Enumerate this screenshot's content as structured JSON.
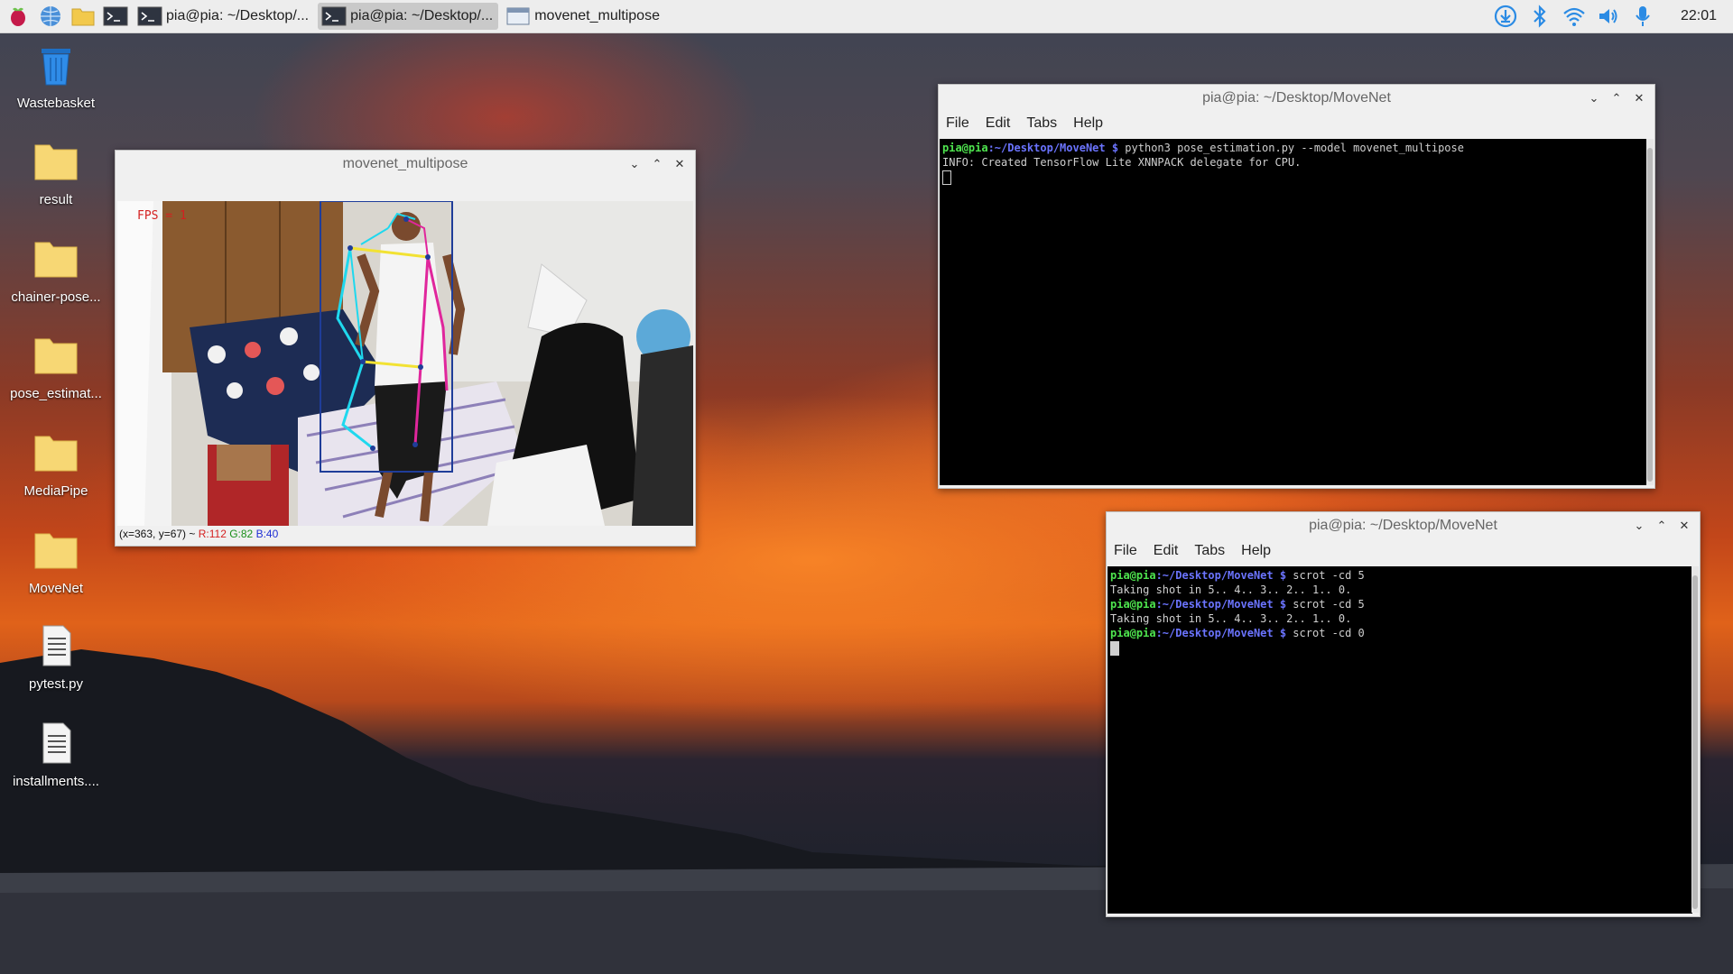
{
  "taskbar": {
    "launchers": [
      {
        "name": "raspberry-menu-icon"
      },
      {
        "name": "browser-icon"
      },
      {
        "name": "file-manager-icon"
      },
      {
        "name": "terminal-icon"
      }
    ],
    "tasks": [
      {
        "label": "pia@pia: ~/Desktop/...",
        "icon": "terminal",
        "active": false
      },
      {
        "label": "pia@pia: ~/Desktop/...",
        "icon": "terminal",
        "active": true
      },
      {
        "label": "movenet_multipose",
        "icon": "window",
        "active": false
      }
    ],
    "tray_icons": [
      "download-icon",
      "bluetooth-icon",
      "wifi-icon",
      "volume-icon",
      "microphone-icon"
    ],
    "clock": "22:01",
    "accent": "#2b8be4"
  },
  "desktop": {
    "icons": [
      {
        "label": "Wastebasket",
        "type": "trash"
      },
      {
        "label": "result",
        "type": "folder"
      },
      {
        "label": "chainer-pose...",
        "type": "folder"
      },
      {
        "label": "pose_estimat...",
        "type": "folder"
      },
      {
        "label": "MediaPipe",
        "type": "folder"
      },
      {
        "label": "MoveNet",
        "type": "folder"
      },
      {
        "label": "pytest.py",
        "type": "file"
      },
      {
        "label": "installments....",
        "type": "file"
      }
    ]
  },
  "camera_window": {
    "title": "movenet_multipose",
    "fps_text": "FPS = 1",
    "status": {
      "coords": "(x=363, y=67) ~",
      "r": "R:112",
      "g": "G:82",
      "b": "B:40"
    }
  },
  "terminal1": {
    "title": "pia@pia: ~/Desktop/MoveNet",
    "menu": [
      "File",
      "Edit",
      "Tabs",
      "Help"
    ],
    "lines": [
      {
        "user": "pia@pia",
        "path": ":~/Desktop/MoveNet $",
        "cmd": " python3 pose_estimation.py --model movenet_multipose"
      },
      {
        "text": "INFO: Created TensorFlow Lite XNNPACK delegate for CPU."
      }
    ]
  },
  "terminal2": {
    "title": "pia@pia: ~/Desktop/MoveNet",
    "menu": [
      "File",
      "Edit",
      "Tabs",
      "Help"
    ],
    "lines": [
      {
        "user": "pia@pia",
        "path": ":~/Desktop/MoveNet $",
        "cmd": " scrot -cd 5"
      },
      {
        "text": "Taking shot in 5.. 4.. 3.. 2.. 1.. 0."
      },
      {
        "user": "pia@pia",
        "path": ":~/Desktop/MoveNet $",
        "cmd": " scrot -cd 5"
      },
      {
        "text": "Taking shot in 5.. 4.. 3.. 2.. 1.. 0."
      },
      {
        "user": "pia@pia",
        "path": ":~/Desktop/MoveNet $",
        "cmd": " scrot -cd 0"
      }
    ]
  }
}
